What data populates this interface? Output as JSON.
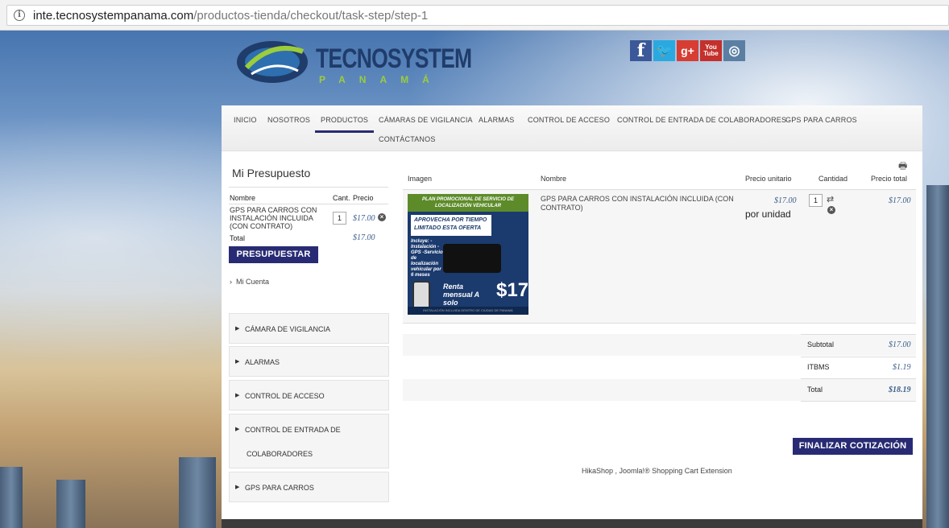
{
  "browser": {
    "url_domain": "inte.tecnosystempanama.com",
    "url_path": "/productos-tienda/checkout/task-step/step-1"
  },
  "logo": {
    "name": "TECNOSYSTEM",
    "sub": "PANAMÁ"
  },
  "social": {
    "facebook": "f",
    "twitter": "🐦",
    "googleplus": "g+",
    "youtube_top": "You",
    "youtube_bottom": "Tube",
    "instagram": "◎"
  },
  "nav": {
    "items": [
      "INICIO",
      "NOSOTROS",
      "PRODUCTOS",
      "CÁMARAS DE VIGILANCIA",
      "ALARMAS",
      "CONTROL DE ACCESO",
      "CONTROL DE ENTRADA DE COLABORADORES",
      "GPS PARA CARROS",
      "CONTÁCTANOS"
    ],
    "active": "PRODUCTOS"
  },
  "mini_cart": {
    "title": "Mi Presupuesto",
    "col_name": "Nombre",
    "col_qty": "Cant.",
    "col_price": "Precio",
    "item_name": "GPS PARA CARROS CON INSTALACIÓN INCLUIDA (CON CONTRATO)",
    "item_qty": "1",
    "item_price": "$17.00",
    "total_label": "Total",
    "total_value": "$17.00",
    "button": "PRESUPUESTAR"
  },
  "account": {
    "link": "Mi Cuenta"
  },
  "categories": [
    "CÁMARA DE VIGILANCIA",
    "ALARMAS",
    "CONTROL DE ACCESO",
    "CONTROL DE ENTRADA DE",
    "COLABORADORES",
    "GPS PARA CARROS"
  ],
  "cart": {
    "headers": {
      "image": "Imagen",
      "name": "Nombre",
      "unit_price": "Precio unitario",
      "qty": "Cantidad",
      "total": "Precio total"
    },
    "item": {
      "name": "GPS PARA CARROS CON INSTALACIÓN INCLUIDA (CON CONTRATO)",
      "unit_price": "$17.00",
      "unit_label": "por unidad",
      "qty": "1",
      "total": "$17.00"
    },
    "promo": {
      "banner": "PLAN PROMOCIONAL DE SERVICIO DE LOCALIZACIÓN VEHICULAR",
      "headline": "APROVECHA POR TIEMPO LIMITADO ESTA OFERTA",
      "includes": "Incluye: -Instalación -GPS -Servicio de localización vehicular por 6 meses",
      "price_text": "Renta mensual A solo",
      "price_big": "$17",
      "footer": "INSTALACIÓN INCLUIDA DENTRO DE CIUDAD DE PANAMÁ"
    },
    "summary": [
      {
        "label": "Subtotal",
        "value": "$17.00"
      },
      {
        "label": "ITBMS",
        "value": "$1.19"
      },
      {
        "label": "Total",
        "value": "$18.19"
      }
    ],
    "button": "FINALIZAR COTIZACIÓN",
    "footer": "HikaShop , Joomla!® Shopping Cart Extension"
  }
}
